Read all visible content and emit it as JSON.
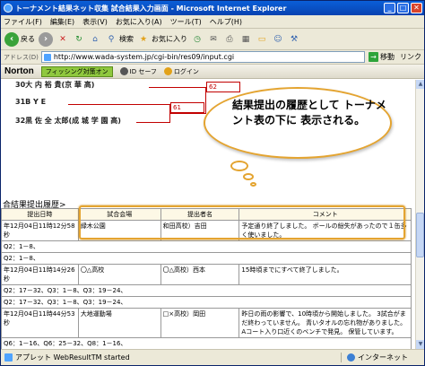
{
  "window": {
    "title": "トーナメント結果ネット収集 試合結果入力画面 - Microsoft Internet Explorer",
    "buttons": {
      "minimize": "_",
      "maximize": "□",
      "close": "✕"
    }
  },
  "menu": [
    "ファイル(F)",
    "編集(E)",
    "表示(V)",
    "お気に入り(A)",
    "ツール(T)",
    "ヘルプ(H)"
  ],
  "toolbar": {
    "back": "戻る",
    "search": "検索",
    "favorites": "お気に入り"
  },
  "address": {
    "label": "アドレス(D)",
    "url": "http://www.wada-system.jp/cgi-bin/res09/input.cgi",
    "go": "移動",
    "links": "リンク"
  },
  "norton": {
    "logo": "Norton",
    "phishing": "フィッシング対策オン",
    "id_safe": "ID セーフ",
    "login": "ログイン"
  },
  "bracket": {
    "players": [
      "30大 内 裕 貴(京   華   高)",
      "31B    Y    E",
      "32黒 佐 全 太郎(成 城 学 園 高)"
    ],
    "scores": [
      "62",
      "61"
    ]
  },
  "callout": {
    "text": "結果提出の履歴として トーナメント表の下に 表示される。"
  },
  "history": {
    "title": "合結果提出履歴>",
    "headers": [
      "提出日時",
      "試合会場",
      "提出者名",
      "コメント"
    ],
    "rows": [
      {
        "date": "年12月04日11時12分58秒",
        "venue": "緑木公園",
        "submitter": "和田高校）吉田",
        "comment": "予定通り終了しました。 ボールの紛失があったので１缶多く使いました。",
        "detail": "Q2：1－8、"
      },
      {
        "date": "",
        "venue": "",
        "submitter": "",
        "comment": "",
        "detail": "Q2：1－8、"
      },
      {
        "date": "年12月04日11時14分26秒",
        "venue": "〇△高校",
        "submitter": "〇△高校）西本",
        "comment": "15時頃までにすべて終了しました。",
        "detail": "Q2：17－32、Q3：1－8、Q3：19－24、"
      },
      {
        "date": "",
        "venue": "",
        "submitter": "",
        "comment": "",
        "detail": "Q2：17－32、Q3：1－8、Q3：19－24、"
      },
      {
        "date": "年12月04日11時44分53秒",
        "venue": "大地運動場",
        "submitter": "□×高校）岡田",
        "comment": "昨日の雨の影響で、10時頃から開始しました。 3試合がまだ終わっていません。 青いタオルの忘れ物がありました。 Aコート入り口近くのベンチで発見。 保管しています。",
        "detail": "Q6：1－16、Q6：25－32、Q8：1－16、"
      }
    ]
  },
  "status": {
    "text": "アプレット WebResultTM started",
    "zone": "インターネット"
  }
}
